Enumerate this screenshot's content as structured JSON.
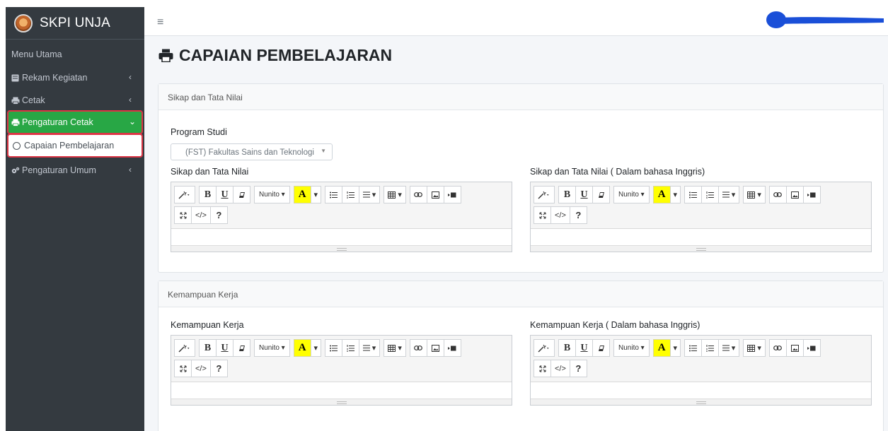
{
  "app": {
    "brand": "SKPI UNJA"
  },
  "sidebar": {
    "menu_header": "Menu Utama",
    "items": [
      {
        "label": "Rekam Kegiatan",
        "icon": "book-icon"
      },
      {
        "label": "Cetak",
        "icon": "print-icon"
      },
      {
        "label": "Pengaturan Cetak",
        "icon": "print-icon",
        "active": true
      },
      {
        "label": "Capaian Pembelajaran",
        "icon": "circle-icon"
      },
      {
        "label": "Pengaturan Umum",
        "icon": "cogs-icon"
      }
    ]
  },
  "topbar": {
    "menu_icon": "hamburger-icon"
  },
  "page": {
    "title": "CAPAIAN PEMBELAJARAN"
  },
  "card1": {
    "header": "Sikap dan Tata Nilai",
    "program_label": "Program Studi",
    "program_value": "(FST) Fakultas Sains dan Teknologi",
    "editor_left_label": "Sikap dan Tata Nilai",
    "editor_right_label": "Sikap dan Tata Nilai ( Dalam bahasa Inggris)"
  },
  "card2": {
    "header": "Kemampuan Kerja",
    "editor_left_label": "Kemampuan Kerja",
    "editor_right_label": "Kemampuan Kerja ( Dalam bahasa Inggris)"
  },
  "toolbar": {
    "bold": "B",
    "underline": "U",
    "font_name": "Nunito",
    "highlight": "A",
    "code": "</>",
    "help": "?"
  },
  "colors": {
    "sidebar_bg": "#343a40",
    "active_green": "#28a745",
    "highlight_box": "#dc3545",
    "content_bg": "#f4f6f9"
  }
}
